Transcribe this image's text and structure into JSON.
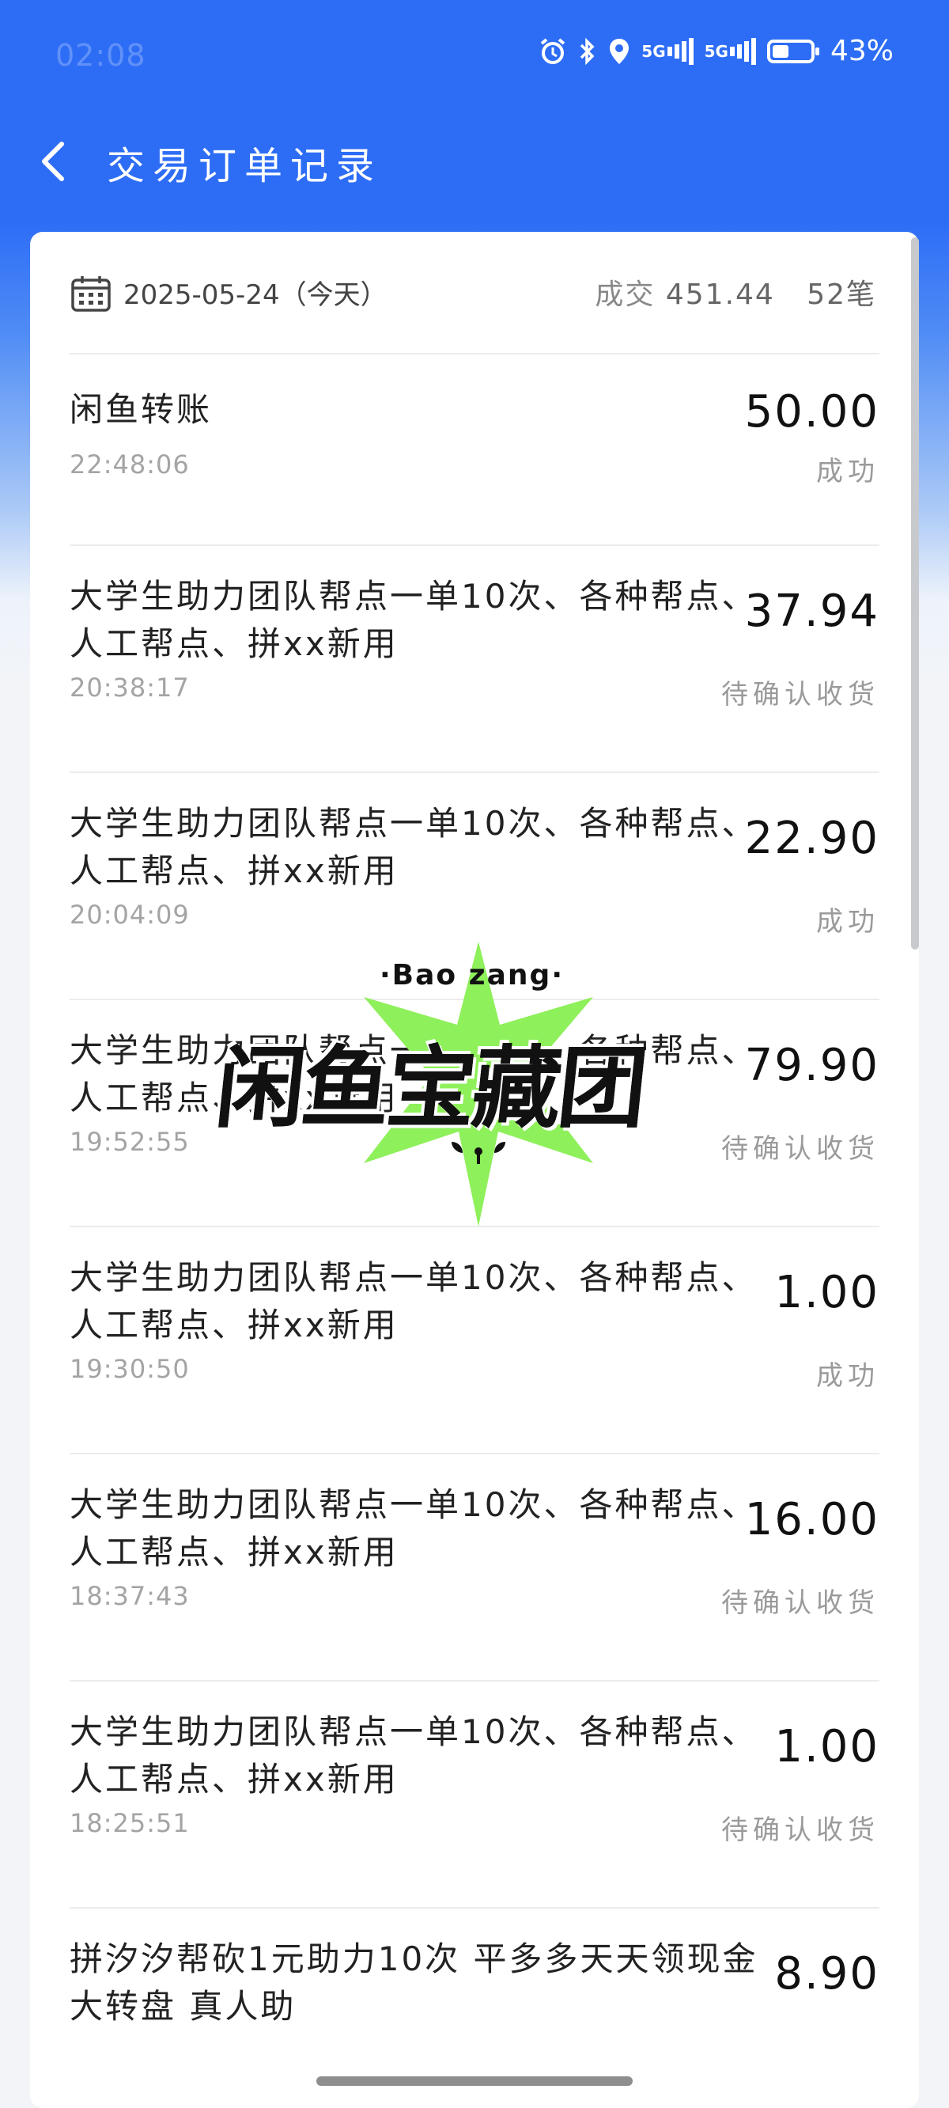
{
  "status_bar": {
    "time": "02:08",
    "network_1": "5G",
    "network_2": "5G",
    "battery": "43%",
    "battery_level": 0.43
  },
  "header": {
    "title": "交易订单记录"
  },
  "summary": {
    "date": "2025-05-24（今天）",
    "total_label": "成交",
    "total_amount": "451.44",
    "count": "52笔"
  },
  "transactions": [
    {
      "title": "闲鱼转账",
      "amount": "50.00",
      "time": "22:48:06",
      "status": "成功"
    },
    {
      "title": "大学生助力团队帮点一单10次、各种帮点、人工帮点、拼xx新用",
      "amount": "37.94",
      "time": "20:38:17",
      "status": "待确认收货"
    },
    {
      "title": "大学生助力团队帮点一单10次、各种帮点、人工帮点、拼xx新用",
      "amount": "22.90",
      "time": "20:04:09",
      "status": "成功"
    },
    {
      "title": "大学生助力团队帮点一单10次、各种帮点、人工帮点、拼xx新用",
      "amount": "79.90",
      "time": "19:52:55",
      "status": "待确认收货"
    },
    {
      "title": "大学生助力团队帮点一单10次、各种帮点、人工帮点、拼xx新用",
      "amount": "1.00",
      "time": "19:30:50",
      "status": "成功"
    },
    {
      "title": "大学生助力团队帮点一单10次、各种帮点、人工帮点、拼xx新用",
      "amount": "16.00",
      "time": "18:37:43",
      "status": "待确认收货"
    },
    {
      "title": "大学生助力团队帮点一单10次、各种帮点、人工帮点、拼xx新用",
      "amount": "1.00",
      "time": "18:25:51",
      "status": "待确认收货"
    },
    {
      "title": "拼汐汐帮砍1元助力10次 平多多天天领现金 大转盘 真人助",
      "amount": "8.90",
      "time": "",
      "status": ""
    }
  ],
  "watermark": {
    "subtitle": "·Bao zang·",
    "text": "闲鱼宝藏团"
  },
  "colors": {
    "header_blue": "#2d6df6",
    "watermark_green": "#8ef05a"
  }
}
